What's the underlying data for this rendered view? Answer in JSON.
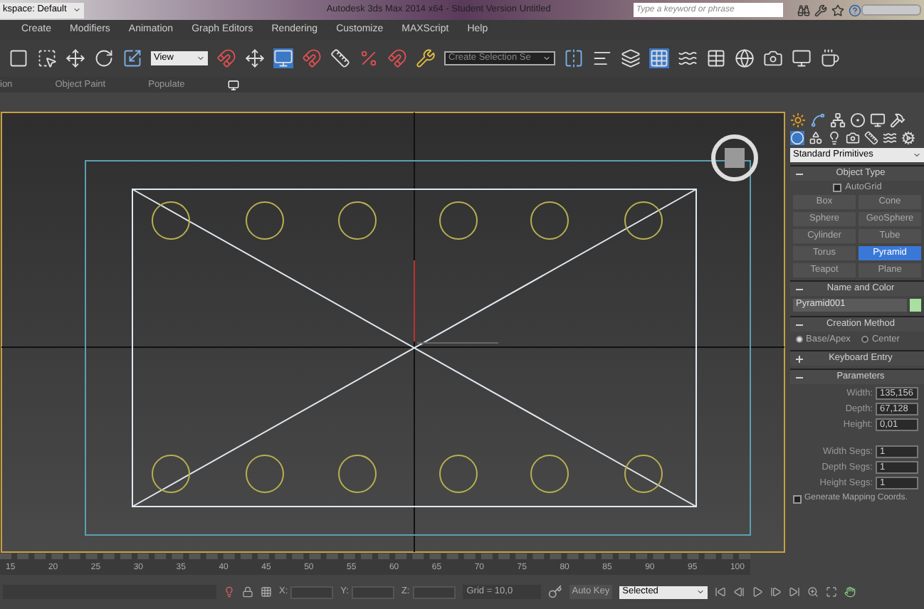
{
  "title_bar": {
    "workspace": "kspace: Default",
    "title": "Autodesk 3ds Max 2014 x64 - Student Version   Untitled",
    "search_placeholder": "Type a keyword or phrase"
  },
  "menu": [
    "Create",
    "Modifiers",
    "Animation",
    "Graph Editors",
    "Rendering",
    "Customize",
    "MAXScript",
    "Help"
  ],
  "toolbar": {
    "reference_dropdown": "View",
    "selection_set_dropdown": "Create Selection Se"
  },
  "ribbon_tabs": [
    "ion",
    "Object Paint",
    "Populate"
  ],
  "command_panel": {
    "category_dropdown": "Standard Primitives",
    "object_type": {
      "title": "Object Type",
      "autogrid": {
        "label": "AutoGrid",
        "checked": false
      },
      "buttons": [
        {
          "label": "Box",
          "selected": false
        },
        {
          "label": "Cone",
          "selected": false
        },
        {
          "label": "Sphere",
          "selected": false
        },
        {
          "label": "GeoSphere",
          "selected": false
        },
        {
          "label": "Cylinder",
          "selected": false
        },
        {
          "label": "Tube",
          "selected": false
        },
        {
          "label": "Torus",
          "selected": false
        },
        {
          "label": "Pyramid",
          "selected": true
        },
        {
          "label": "Teapot",
          "selected": false
        },
        {
          "label": "Plane",
          "selected": false
        }
      ]
    },
    "name_and_color": {
      "title": "Name and Color",
      "name": "Pyramid001",
      "color": "#a8e0a0"
    },
    "creation_method": {
      "title": "Creation Method",
      "options": [
        {
          "label": "Base/Apex",
          "selected": true
        },
        {
          "label": "Center",
          "selected": false
        }
      ]
    },
    "keyboard_entry": {
      "title": "Keyboard Entry",
      "expanded": false
    },
    "parameters": {
      "title": "Parameters",
      "fields": [
        {
          "label": "Width:",
          "value": "135,156"
        },
        {
          "label": "Depth:",
          "value": "67,128"
        },
        {
          "label": "Height:",
          "value": "0,01"
        }
      ],
      "segs": [
        {
          "label": "Width Segs:",
          "value": "1"
        },
        {
          "label": "Depth Segs:",
          "value": "1"
        },
        {
          "label": "Height Segs:",
          "value": "1"
        }
      ],
      "mapping": {
        "label": "Generate Mapping Coords.",
        "checked": false
      }
    }
  },
  "timeline": {
    "ticks": [
      "15",
      "20",
      "25",
      "30",
      "35",
      "40",
      "45",
      "50",
      "55",
      "60",
      "65",
      "70",
      "75",
      "80",
      "85",
      "90",
      "95",
      "100"
    ]
  },
  "status_bar": {
    "x_label": "X:",
    "y_label": "Y:",
    "z_label": "Z:",
    "grid": "Grid = 10,0",
    "auto_key": "Auto Key",
    "key_filter": "Selected"
  }
}
